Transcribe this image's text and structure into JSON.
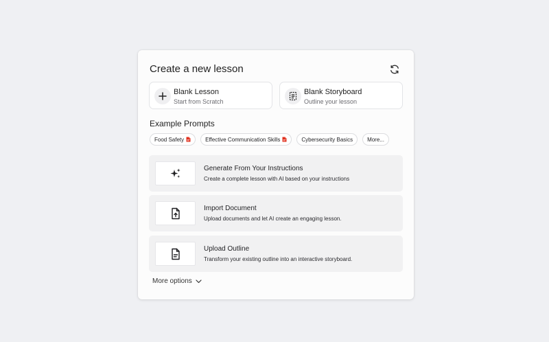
{
  "dialog": {
    "title": "Create a new lesson",
    "refresh_icon": "refresh-icon"
  },
  "blank_options": [
    {
      "title": "Blank Lesson",
      "subtitle": "Start from Scratch",
      "icon": "plus-icon"
    },
    {
      "title": "Blank Storyboard",
      "subtitle": "Outline your lesson",
      "icon": "storyboard-icon"
    }
  ],
  "examples": {
    "title": "Example Prompts",
    "chips": [
      {
        "label": "Food Safety",
        "icon": "pdf-icon"
      },
      {
        "label": "Effective Communication Skills",
        "icon": "pdf-icon"
      },
      {
        "label": "Cybersecurity Basics"
      },
      {
        "label": "More..."
      }
    ]
  },
  "options": [
    {
      "title": "Generate From Your Instructions",
      "description": "Create a complete lesson with AI based on your instructions",
      "icon": "sparkles-icon"
    },
    {
      "title": "Import Document",
      "description": "Upload documents and let AI create an engaging lesson.",
      "icon": "file-upload-icon"
    },
    {
      "title": "Upload Outline",
      "description": "Transform your existing outline into an interactive storyboard.",
      "icon": "file-text-icon"
    }
  ],
  "more_options": {
    "label": "More options",
    "icon": "chevron-down-icon"
  },
  "colors": {
    "background": "#eff0f3",
    "card": "#fcfcfc",
    "option_bg": "#f1f1f2",
    "pdf_red": "#e0301e"
  }
}
